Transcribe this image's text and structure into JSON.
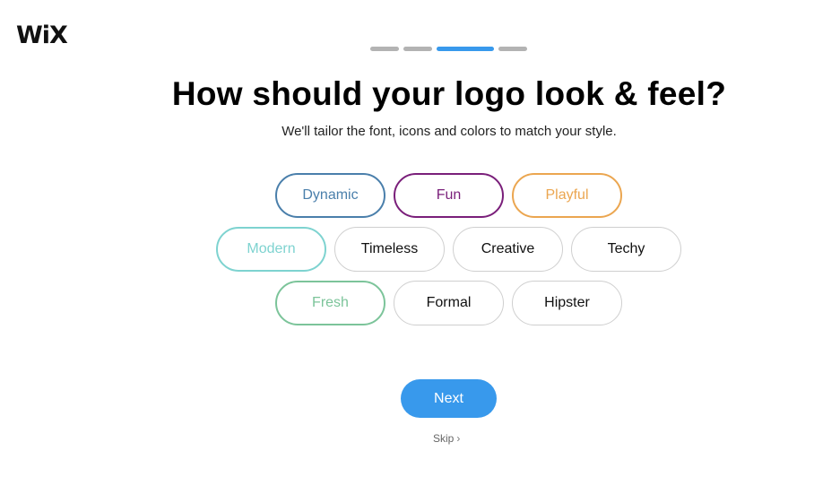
{
  "brand": {
    "logo_text": "WiX"
  },
  "progress": {
    "total_steps": 4,
    "current_step": 3
  },
  "header": {
    "title": "How should your logo look & feel?",
    "subtitle": "We'll tailor the font, icons and colors to match your style."
  },
  "styles": [
    {
      "label": "Dynamic",
      "selected": true,
      "color": "#4a7fab"
    },
    {
      "label": "Fun",
      "selected": true,
      "color": "#7a1f7a"
    },
    {
      "label": "Playful",
      "selected": true,
      "color": "#eba650"
    },
    {
      "label": "Modern",
      "selected": true,
      "color": "#7ed3d0"
    },
    {
      "label": "Timeless",
      "selected": false,
      "color": "#111111"
    },
    {
      "label": "Creative",
      "selected": false,
      "color": "#111111"
    },
    {
      "label": "Techy",
      "selected": false,
      "color": "#111111"
    },
    {
      "label": "Fresh",
      "selected": true,
      "color": "#7cc49a"
    },
    {
      "label": "Formal",
      "selected": false,
      "color": "#111111"
    },
    {
      "label": "Hipster",
      "selected": false,
      "color": "#111111"
    }
  ],
  "actions": {
    "next_label": "Next",
    "skip_label": "Skip",
    "skip_icon": "chevron-right-icon"
  },
  "colors": {
    "accent": "#3899ec",
    "progress_inactive": "#b3b3b3"
  }
}
